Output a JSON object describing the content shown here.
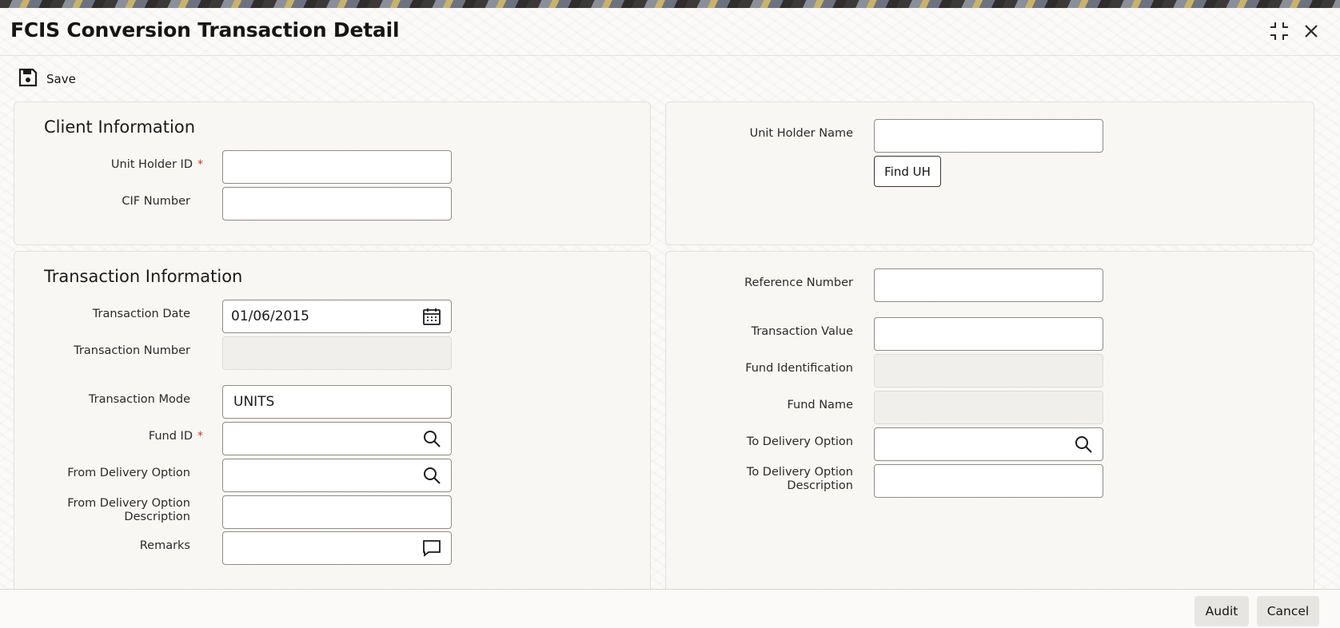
{
  "window": {
    "title": "FCIS Conversion Transaction Detail",
    "maximize_icon": "maximize-icon",
    "close_icon": "close-icon"
  },
  "toolbar": {
    "save_label": "Save",
    "save_icon": "floppy-disk-icon"
  },
  "client_info": {
    "title": "Client Information",
    "unit_holder_id": {
      "label": "Unit Holder ID",
      "required_mark": "*",
      "value": ""
    },
    "cif_number": {
      "label": "CIF Number",
      "value": ""
    },
    "unit_holder_name": {
      "label": "Unit Holder Name",
      "value": ""
    },
    "find_uh_label": "Find UH"
  },
  "transaction_info": {
    "title": "Transaction Information",
    "transaction_date": {
      "label": "Transaction Date",
      "value": "01/06/2015",
      "icon": "calendar-icon"
    },
    "transaction_number": {
      "label": "Transaction Number",
      "value": ""
    },
    "transaction_mode": {
      "label": "Transaction Mode",
      "value": "UNITS"
    },
    "fund_id": {
      "label": "Fund ID",
      "required_mark": "*",
      "value": "",
      "icon": "search-icon"
    },
    "from_delivery_option": {
      "label": "From Delivery Option",
      "value": "",
      "icon": "search-icon"
    },
    "from_delivery_option_desc": {
      "label_line1": "From Delivery Option",
      "label_line2": "Description",
      "value": ""
    },
    "remarks": {
      "label": "Remarks",
      "value": "",
      "icon": "comment-icon"
    },
    "reference_number": {
      "label": "Reference Number",
      "value": ""
    },
    "transaction_value": {
      "label": "Transaction Value",
      "value": ""
    },
    "fund_identification": {
      "label": "Fund Identification",
      "value": ""
    },
    "fund_name": {
      "label": "Fund Name",
      "value": ""
    },
    "to_delivery_option": {
      "label": "To Delivery Option",
      "value": "",
      "icon": "search-icon"
    },
    "to_delivery_option_desc": {
      "label_line1": "To Delivery Option",
      "label_line2": "Description",
      "value": ""
    }
  },
  "footer": {
    "audit_label": "Audit",
    "cancel_label": "Cancel"
  }
}
